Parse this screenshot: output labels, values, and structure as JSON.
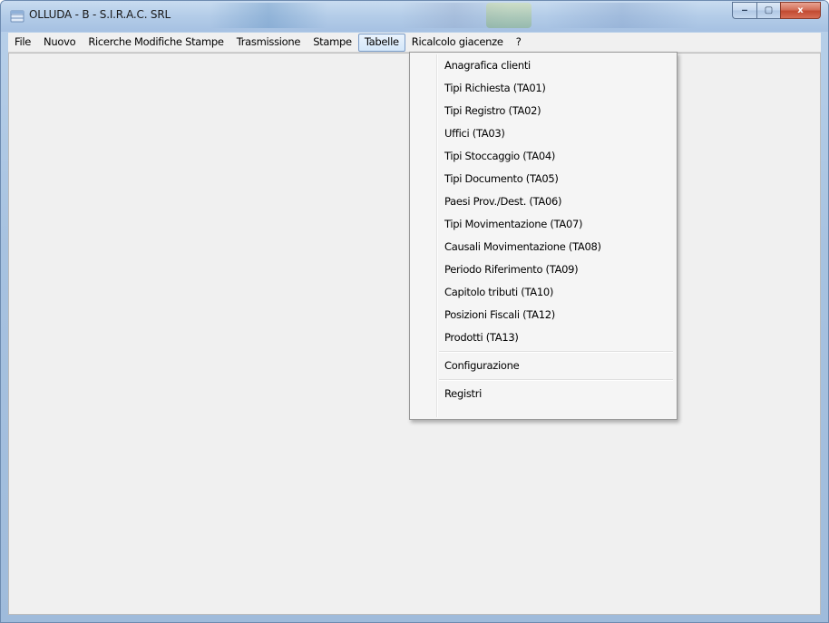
{
  "window": {
    "title": "OLLUDA - B - S.I.R.A.C. SRL",
    "icon": "database-icon",
    "caption": {
      "minimize_icon": "minimize-icon",
      "maximize_icon": "maximize-icon",
      "close_icon": "close-icon",
      "minimize_glyph": "‒",
      "maximize_glyph": "▢",
      "close_glyph": "x"
    }
  },
  "menubar": {
    "items": [
      {
        "label": "File"
      },
      {
        "label": "Nuovo"
      },
      {
        "label": "Ricerche Modifiche Stampe"
      },
      {
        "label": "Trasmissione"
      },
      {
        "label": "Stampe"
      },
      {
        "label": "Tabelle",
        "active": true
      },
      {
        "label": "Ricalcolo giacenze"
      },
      {
        "label": "?"
      }
    ]
  },
  "dropdown": {
    "group1": [
      "Anagrafica clienti",
      "Tipi Richiesta (TA01)",
      "Tipi Registro (TA02)",
      "Uffici (TA03)",
      "Tipi Stoccaggio (TA04)",
      "Tipi Documento (TA05)",
      "Paesi Prov./Dest. (TA06)",
      "Tipi Movimentazione (TA07)",
      "Causali Movimentazione (TA08)",
      "Periodo Riferimento (TA09)",
      "Capitolo tributi (TA10)",
      "Posizioni Fiscali (TA12)",
      "Prodotti (TA13)"
    ],
    "group2": [
      "Configurazione"
    ],
    "group3": [
      "Registri"
    ]
  },
  "colors": {
    "menu_active_border": "#7a9cc8",
    "client_background": "#f0f0f0",
    "close_button": "#c24a31"
  }
}
